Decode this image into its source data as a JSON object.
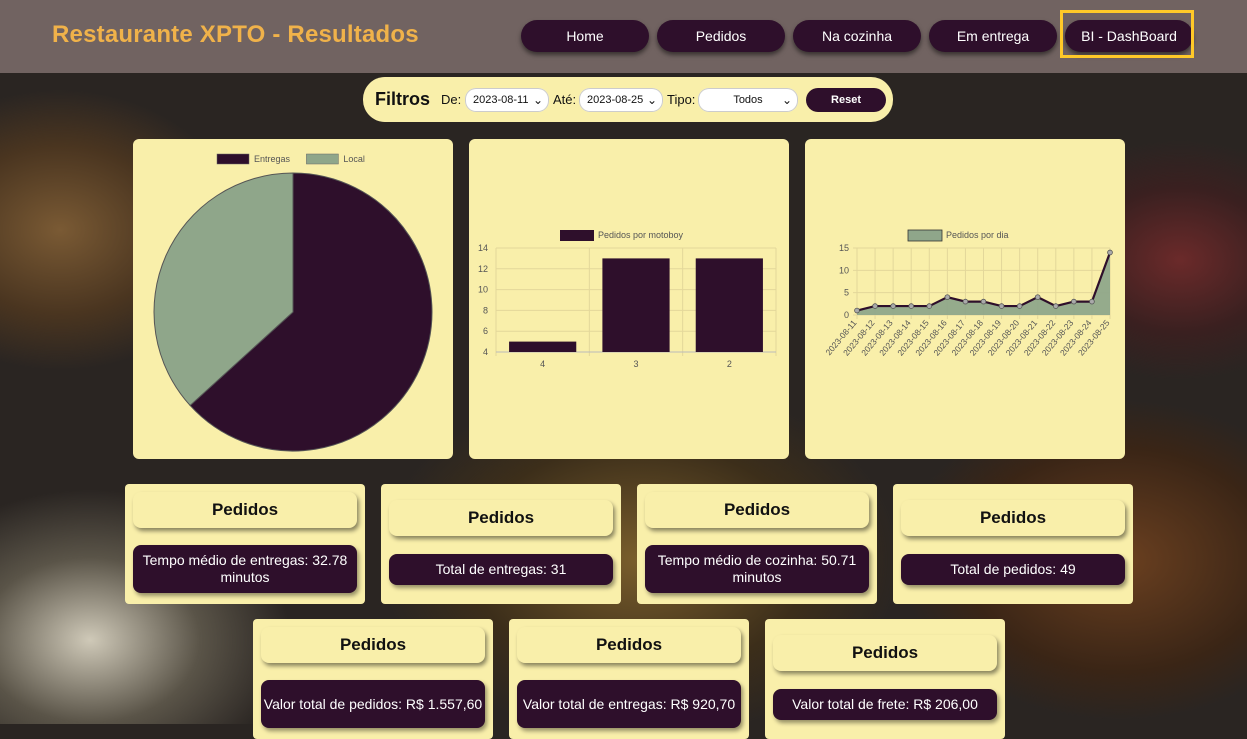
{
  "header": {
    "title": "Restaurante XPTO - Resultados",
    "nav": [
      "Home",
      "Pedidos",
      "Na cozinha",
      "Em entrega",
      "BI - DashBoard"
    ],
    "active_nav": "BI - DashBoard"
  },
  "filters": {
    "title": "Filtros",
    "from_label": "De:",
    "from_value": "2023-08-11",
    "to_label": "Até:",
    "to_value": "2023-08-25",
    "type_label": "Tipo:",
    "type_value": "Todos",
    "reset_label": "Reset"
  },
  "colors": {
    "accent": "#2e0f2b",
    "panel": "#f9efaa",
    "header": "#716361",
    "title": "#f0b24a",
    "highlight": "#ffc928",
    "secondary_series": "#8fa68a"
  },
  "chart_data": [
    {
      "type": "pie",
      "legend": [
        "Entregas",
        "Local"
      ],
      "values": [
        31,
        18
      ],
      "colors": [
        "#2e0f2b",
        "#8fa68a"
      ],
      "legend_position": "top"
    },
    {
      "type": "bar",
      "series": [
        {
          "name": "Pedidos por motoboy",
          "values": [
            5,
            13,
            13
          ]
        }
      ],
      "categories": [
        "4",
        "3",
        "2"
      ],
      "ylim": [
        4,
        14
      ],
      "yticks": [
        4,
        6,
        8,
        10,
        12,
        14
      ],
      "grid": true,
      "legend_position": "top"
    },
    {
      "type": "area",
      "series": [
        {
          "name": "Pedidos por dia",
          "values": [
            1,
            2,
            2,
            2,
            2,
            4,
            3,
            3,
            2,
            2,
            4,
            2,
            3,
            3,
            14
          ]
        }
      ],
      "x": [
        "2023-08-11",
        "2023-08-12",
        "2023-08-13",
        "2023-08-14",
        "2023-08-15",
        "2023-08-16",
        "2023-08-17",
        "2023-08-18",
        "2023-08-19",
        "2023-08-20",
        "2023-08-21",
        "2023-08-22",
        "2023-08-23",
        "2023-08-24",
        "2023-08-25"
      ],
      "ylim": [
        0,
        15
      ],
      "yticks": [
        0,
        5,
        10,
        15
      ],
      "grid": true,
      "legend_position": "top"
    }
  ],
  "cards": [
    {
      "title": "Pedidos",
      "value": "Tempo médio de entregas: 32.78 minutos"
    },
    {
      "title": "Pedidos",
      "value": "Total de entregas: 31"
    },
    {
      "title": "Pedidos",
      "value": "Tempo médio de cozinha: 50.71 minutos"
    },
    {
      "title": "Pedidos",
      "value": "Total de pedidos: 49"
    },
    {
      "title": "Pedidos",
      "value": "Valor total de pedidos: R$ 1.557,60"
    },
    {
      "title": "Pedidos",
      "value": "Valor total de entregas: R$ 920,70"
    },
    {
      "title": "Pedidos",
      "value": "Valor total de frete: R$ 206,00"
    }
  ]
}
